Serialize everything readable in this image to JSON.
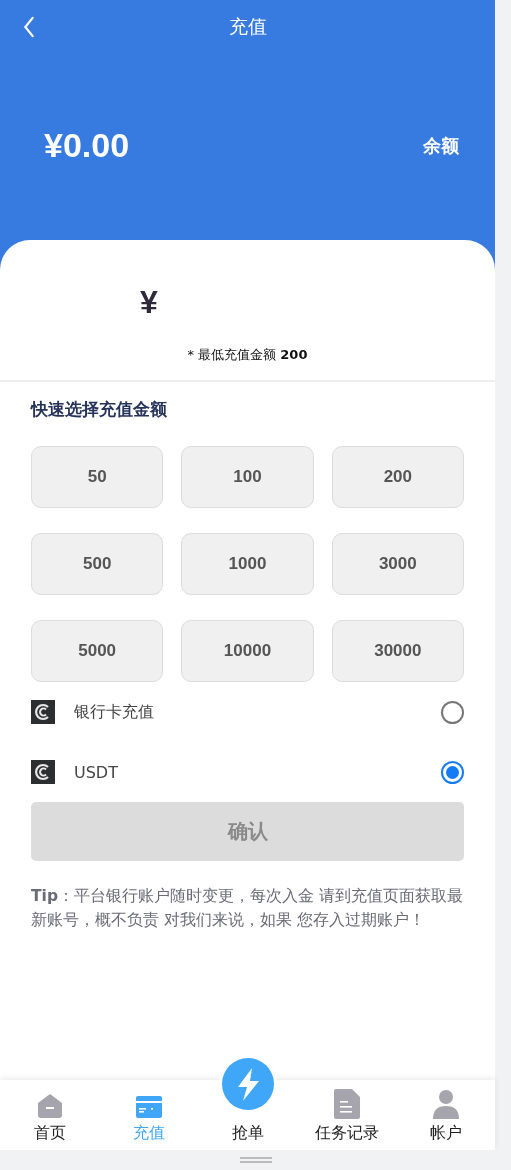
{
  "header": {
    "title": "充值",
    "balance": "¥0.00",
    "balance_label": "余额"
  },
  "amount_field": {
    "prefix": "¥",
    "note": "* 最低充值金额 **200**"
  },
  "quick_amounts": {
    "title": "快速选择充值金额",
    "options": [
      "50",
      "100",
      "200",
      "500",
      "1000",
      "3000",
      "5000",
      "10000",
      "30000"
    ]
  },
  "payment_methods": [
    {
      "label": "银行卡充值",
      "selected": false
    },
    {
      "label": "USDT",
      "selected": true
    }
  ],
  "confirm_button": {
    "label": "确认",
    "disabled": true
  },
  "tip": "**Tip**：平台银行账户随时变更，每次入金 请到充值页面获取最新账号，概不负责 对我们来说，如果 您存入过期账户！",
  "bottom_nav": [
    {
      "label": "首页",
      "kind": "home",
      "selected": false
    },
    {
      "label": "充值",
      "kind": "card",
      "selected": true
    },
    {
      "label": "抢单",
      "kind": "center",
      "selected": false
    },
    {
      "label": "任务记录",
      "kind": "doc",
      "selected": false
    },
    {
      "label": "帐户",
      "kind": "user",
      "selected": false
    }
  ]
}
